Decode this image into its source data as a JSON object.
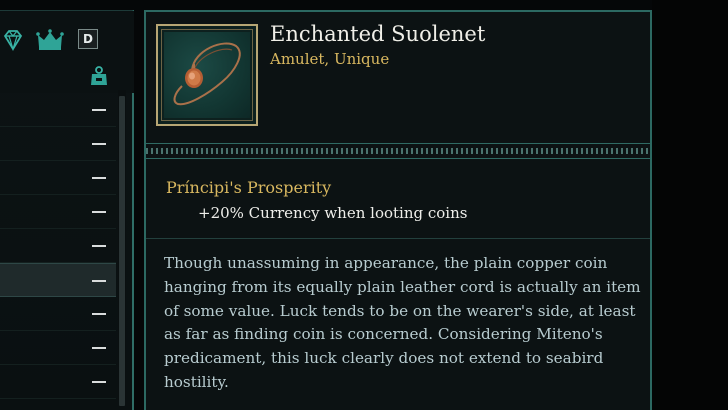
{
  "inventory": {
    "icons": [
      "gem-icon",
      "crown-icon",
      "weight-icon"
    ],
    "d_badge": "D",
    "rows": [
      {
        "selected": false
      },
      {
        "selected": false
      },
      {
        "selected": false
      },
      {
        "selected": false
      },
      {
        "selected": false
      },
      {
        "selected": true
      },
      {
        "selected": false
      },
      {
        "selected": false
      },
      {
        "selected": false
      }
    ]
  },
  "item": {
    "name": "Enchanted Suolenet",
    "type": "Amulet, Unique",
    "icon": "amulet-coin-icon",
    "perk": {
      "title": "Príncipi's Prosperity",
      "effect": "+20% Currency when looting coins"
    },
    "lore": "Though unassuming in appearance, the plain copper coin hanging from its equally plain leather cord is actually an item of some value. Luck tends to be on the wearer's side, at least as far as finding coin is concerned. Considering Miteno's predicament, this luck clearly does not extend to seabird hostility."
  },
  "colors": {
    "accent_teal": "#2c6962",
    "gold": "#d9b860",
    "lore_text": "#b8ccd0",
    "panel_bg": "#0c1213"
  }
}
